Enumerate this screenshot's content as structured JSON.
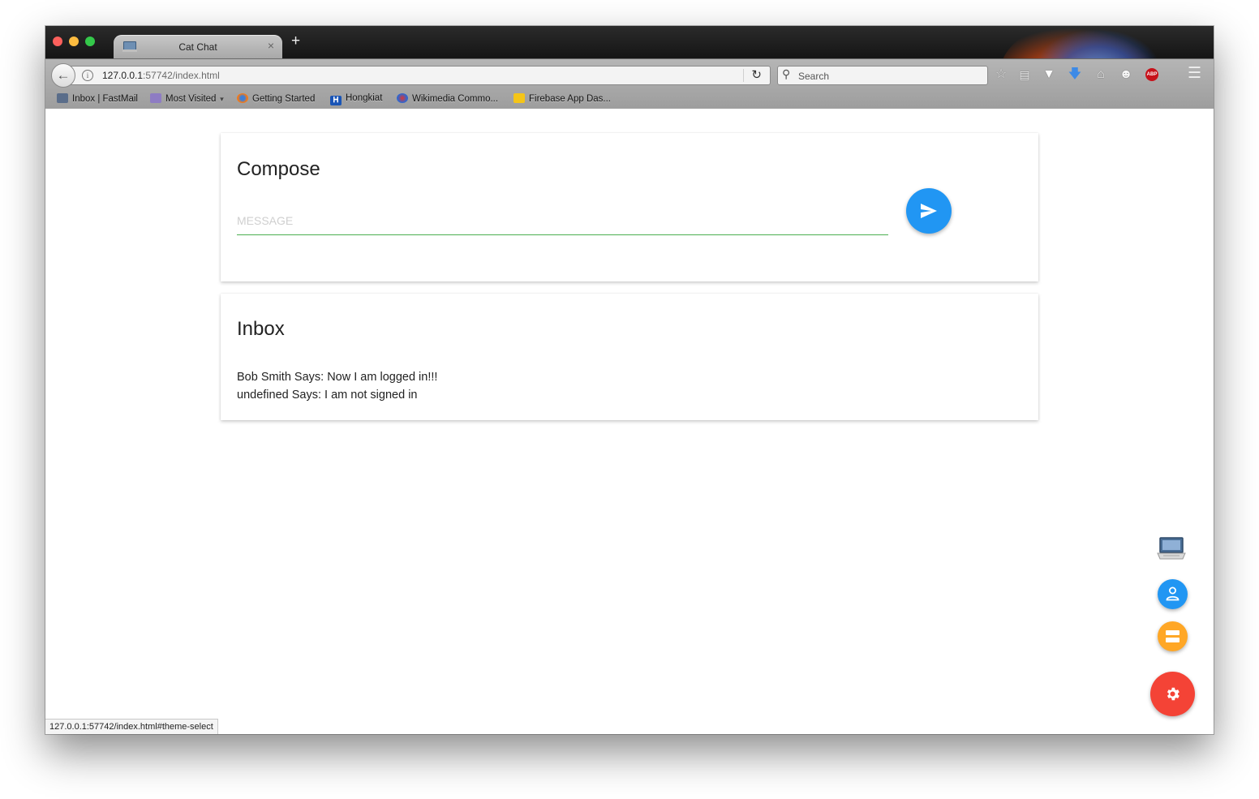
{
  "browser": {
    "tab_title": "Cat Chat",
    "new_tab_symbol": "+",
    "tab_close_symbol": "×",
    "url_host": "127.0.0.1",
    "url_path": ":57742/index.html",
    "search_placeholder": "Search",
    "bookmarks": [
      {
        "label": "Inbox | FastMail",
        "icon": "mail-icon"
      },
      {
        "label": "Most Visited",
        "icon": "most-visited-icon"
      },
      {
        "label": "Getting Started",
        "icon": "firefox-icon"
      },
      {
        "label": "Hongkiat",
        "icon": "hongkiat-icon"
      },
      {
        "label": "Wikimedia Commo...",
        "icon": "wikimedia-icon"
      },
      {
        "label": "Firebase App Das...",
        "icon": "firebase-icon"
      }
    ],
    "status_text": "127.0.0.1:57742/index.html#theme-select"
  },
  "compose": {
    "title": "Compose",
    "message_placeholder": "MESSAGE",
    "message_value": ""
  },
  "inbox": {
    "title": "Inbox",
    "messages": [
      "Bob Smith Says: Now I am logged in!!!",
      "undefined Says: I am not signed in"
    ]
  },
  "colors": {
    "send_button": "#2196f3",
    "user_fab": "#2196f3",
    "list_fab": "#ffa726",
    "settings_fab": "#f44336",
    "input_underline": "#4caf50"
  }
}
